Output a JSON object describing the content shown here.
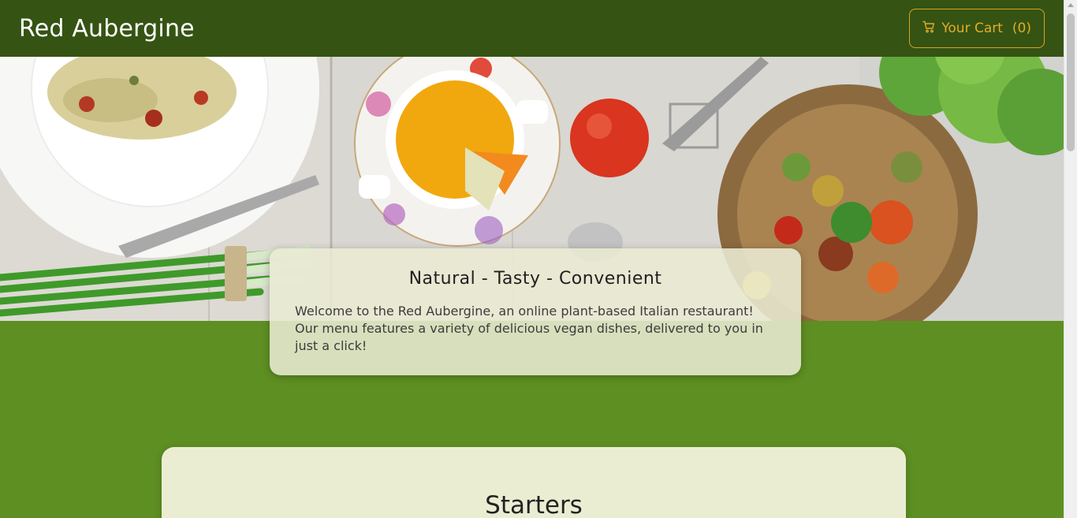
{
  "header": {
    "brand": "Red Aubergine",
    "cart_label": "Your Cart",
    "cart_count": "(0)"
  },
  "hero": {
    "image_alt": "Vegetarian dishes on a wooden table"
  },
  "summary": {
    "heading": "Natural - Tasty - Convenient",
    "text_1": "Welcome to the Red Aubergine, an online plant-based Italian restaurant!",
    "text_2": "Our menu features a variety of delicious vegan dishes, delivered to you in just a click!"
  },
  "menu": {
    "section_title": "Starters"
  },
  "icons": {
    "cart": "cart-icon"
  },
  "colors": {
    "header": "#355313",
    "page": "#5e8f22",
    "accent": "#e2ad26",
    "card": "#ebedd3"
  }
}
